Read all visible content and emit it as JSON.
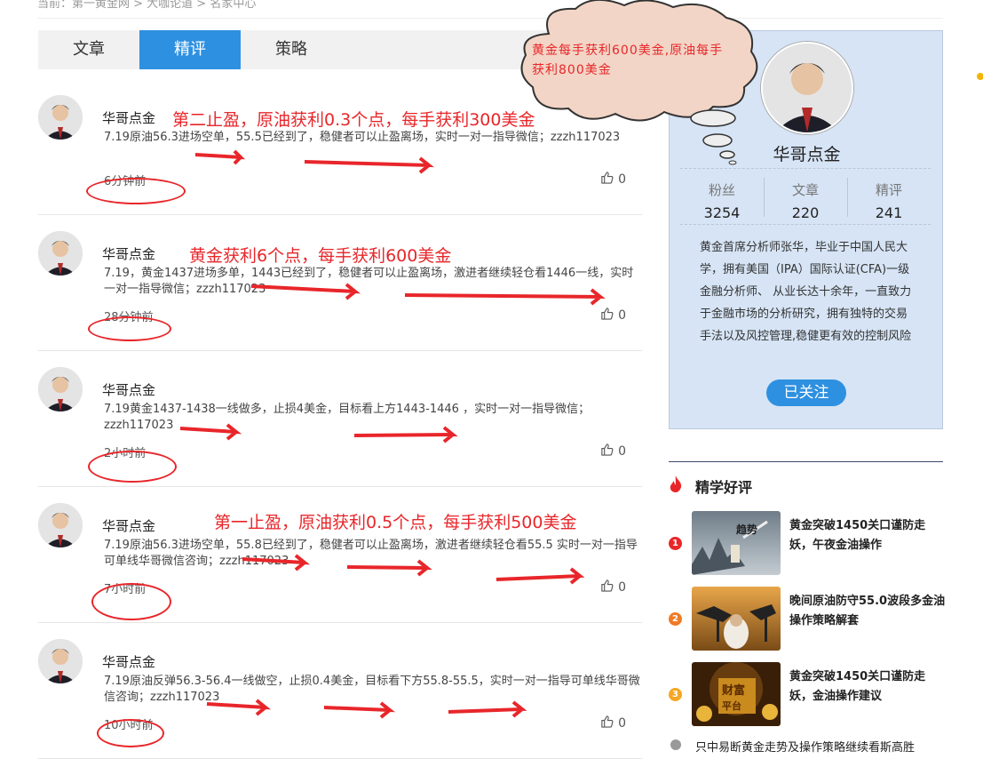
{
  "breadcrumb": "当前：第一黄金网 > 大咖论道 > 名家中心",
  "tabs": [
    {
      "label": "文章",
      "active": false
    },
    {
      "label": "精评",
      "active": true
    },
    {
      "label": "策略",
      "active": false
    }
  ],
  "posts": [
    {
      "author": "华哥点金",
      "text": "7.19原油56.3进场空单，55.5已经到了，稳健者可以止盈离场，实时一对一指导微信；zzzh117023",
      "time": "6分钟前",
      "likes": "0",
      "annotation": "第二止盈，原油获利0.3个点，每手获利300美金"
    },
    {
      "author": "华哥点金",
      "text": "7.19，黄金1437进场多单，1443已经到了，稳健者可以止盈离场，激进者继续轻仓看1446一线，实时一对一指导微信；zzzh117023",
      "time": "28分钟前",
      "likes": "0",
      "annotation": "黄金获利6个点，每手获利600美金"
    },
    {
      "author": "华哥点金",
      "text": "7.19黄金1437-1438一线做多，止损4美金，目标看上方1443-1446 ，实时一对一指导微信；zzzh117023",
      "time": "2小时前",
      "likes": "0",
      "annotation": ""
    },
    {
      "author": "华哥点金",
      "text": "7.19原油56.3进场空单，55.8已经到了，稳健者可以止盈离场，激进者继续轻仓看55.5 实时一对一指导可单线华哥微信咨询；zzzh117023",
      "time": "7小时前",
      "likes": "0",
      "annotation": "第一止盈，原油获利0.5个点，每手获利500美金"
    },
    {
      "author": "华哥点金",
      "text": "7.19原油反弹56.3-56.4一线做空，止损0.4美金，目标看下方55.8-55.5，实时一对一指导可单线华哥微信咨询；zzzh117023",
      "time": "10小时前",
      "likes": "0",
      "annotation": ""
    }
  ],
  "bubble": "黄金每手获利600美金,原油每手获利800美金",
  "profile": {
    "name": "华哥点金",
    "stats": [
      {
        "label": "粉丝",
        "value": "3254"
      },
      {
        "label": "文章",
        "value": "220"
      },
      {
        "label": "精评",
        "value": "241"
      }
    ],
    "bio": "黄金首席分析师张华，毕业于中国人民大学，拥有美国（IPA）国际认证(CFA)一级金融分析师、 从业长达十余年，一直致力于金融市场的分析研究，拥有独特的交易手法以及风控管理,稳健更有效的控制风险",
    "follow": "已关注"
  },
  "recommend": {
    "title": "精学好评",
    "items": [
      {
        "num": "1",
        "title": "黄金突破1450关口谨防走妖，午夜金油操作",
        "color": "#e8262a"
      },
      {
        "num": "2",
        "title": "晚间原油防守55.0波段多金油操作策略解套",
        "color": "#f07a25"
      },
      {
        "num": "3",
        "title": "黄金突破1450关口谨防走妖，金油操作建议",
        "color": "#f5a623"
      }
    ],
    "next": "只中易断黄金走势及操作策略继续看斯高胜"
  },
  "colors": {
    "accent": "#2e90e0",
    "annotation_red": "#e8262a",
    "profile_bg": "#d6e4f5"
  }
}
